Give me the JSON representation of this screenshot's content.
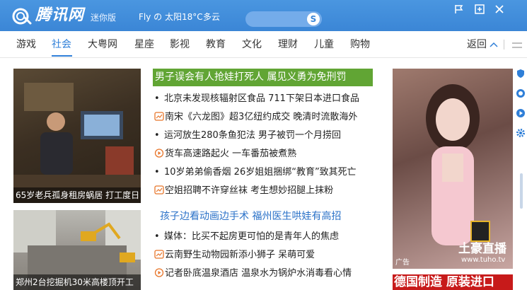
{
  "titlebar": {
    "brand": "腾讯网",
    "mini_label": "迷你版",
    "user": "Fly の 太阳",
    "temperature": "18°C",
    "weather": "多云",
    "search_placeholder": "",
    "search_icon_char": "S",
    "logo_icon": "qq-logo-icon",
    "pin_icon": "pin-icon",
    "new_window_icon": "new-window-icon",
    "close_icon": "close-icon",
    "accent_color": "#3b86d6"
  },
  "nav": {
    "items": [
      "游戏",
      "社会",
      "大粤网",
      "星座",
      "影视",
      "教育",
      "文化",
      "理财",
      "儿童",
      "购物"
    ],
    "active_index": 1,
    "back_label": "返回"
  },
  "photos": [
    {
      "caption": "65岁老兵孤身租房蜗居 打工度日"
    },
    {
      "caption": "郑州2台挖掘机30米高楼顶开工"
    }
  ],
  "headline": "男子误会有人抢娃打死人 属见义勇为免刑罚",
  "news_group_1": [
    {
      "text": "北京未发现核辐射区食品 711下架日本进口食品",
      "icon": "bullet"
    },
    {
      "text": "南宋《六龙图》超3亿纽约成交 晚清时流散海外",
      "icon": "image-icon"
    },
    {
      "text": "运河放生280条鱼犯法 男子被罚一个月捞回",
      "icon": "bullet"
    },
    {
      "text": "货车高速路起火 一车番茄被煮熟",
      "icon": "play-icon"
    },
    {
      "text": "10岁弟弟偷香烟 26岁姐姐捆绑“教育”致其死亡",
      "icon": "bullet"
    },
    {
      "text": "空姐招聘不许穿丝袜 考生想妙招腿上抹粉",
      "icon": "image-icon"
    }
  ],
  "headline2": "孩子边看动画边手术 福州医生哄娃有高招",
  "news_group_2": [
    {
      "text": "媒体：比买不起房更可怕的是青年人的焦虑",
      "icon": "bullet"
    },
    {
      "text": "云南野生动物园新添小狮子 呆萌可爱",
      "icon": "image-icon"
    },
    {
      "text": "记者卧底温泉酒店 温泉水为锅炉水消毒看心情",
      "icon": "play-icon"
    }
  ],
  "ad": {
    "tag": "广告",
    "logo_text": "土豪直播",
    "logo_url_text": "www.tuho.tv",
    "banner_text": "德国制造 原装进口"
  },
  "side_tools": [
    "shield-icon",
    "qq-icon",
    "play-circle-icon",
    "gear-icon"
  ]
}
